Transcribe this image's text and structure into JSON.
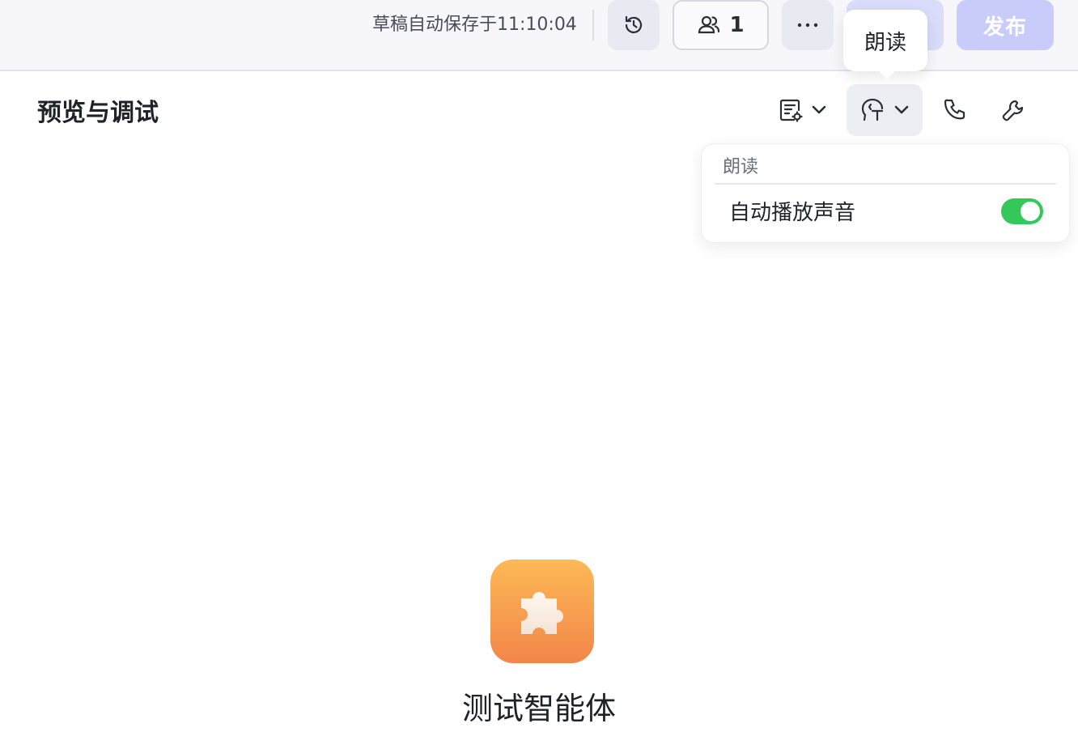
{
  "header": {
    "save_status": "草稿自动保存于11:10:04",
    "collaborators_count": "1",
    "publish_label": "发布"
  },
  "tooltip": {
    "text": "朗读"
  },
  "panel": {
    "title": "预览与调试"
  },
  "dropdown": {
    "header": "朗读",
    "item_label": "自动播放声音",
    "toggle_on": true
  },
  "agent": {
    "name": "测试智能体"
  },
  "icons": {
    "history": "history-icon",
    "collaborators": "users-icon",
    "more": "more-icon",
    "doc": "document-settings-icon",
    "voice": "voice-text-icon",
    "phone": "phone-icon",
    "wrench": "wrench-icon",
    "agent": "puzzle-icon"
  },
  "colors": {
    "publish_bg": "#c9ccfb",
    "toggle_on": "#34c759",
    "avatar_top": "#fdb956",
    "avatar_bottom": "#f2864a"
  }
}
